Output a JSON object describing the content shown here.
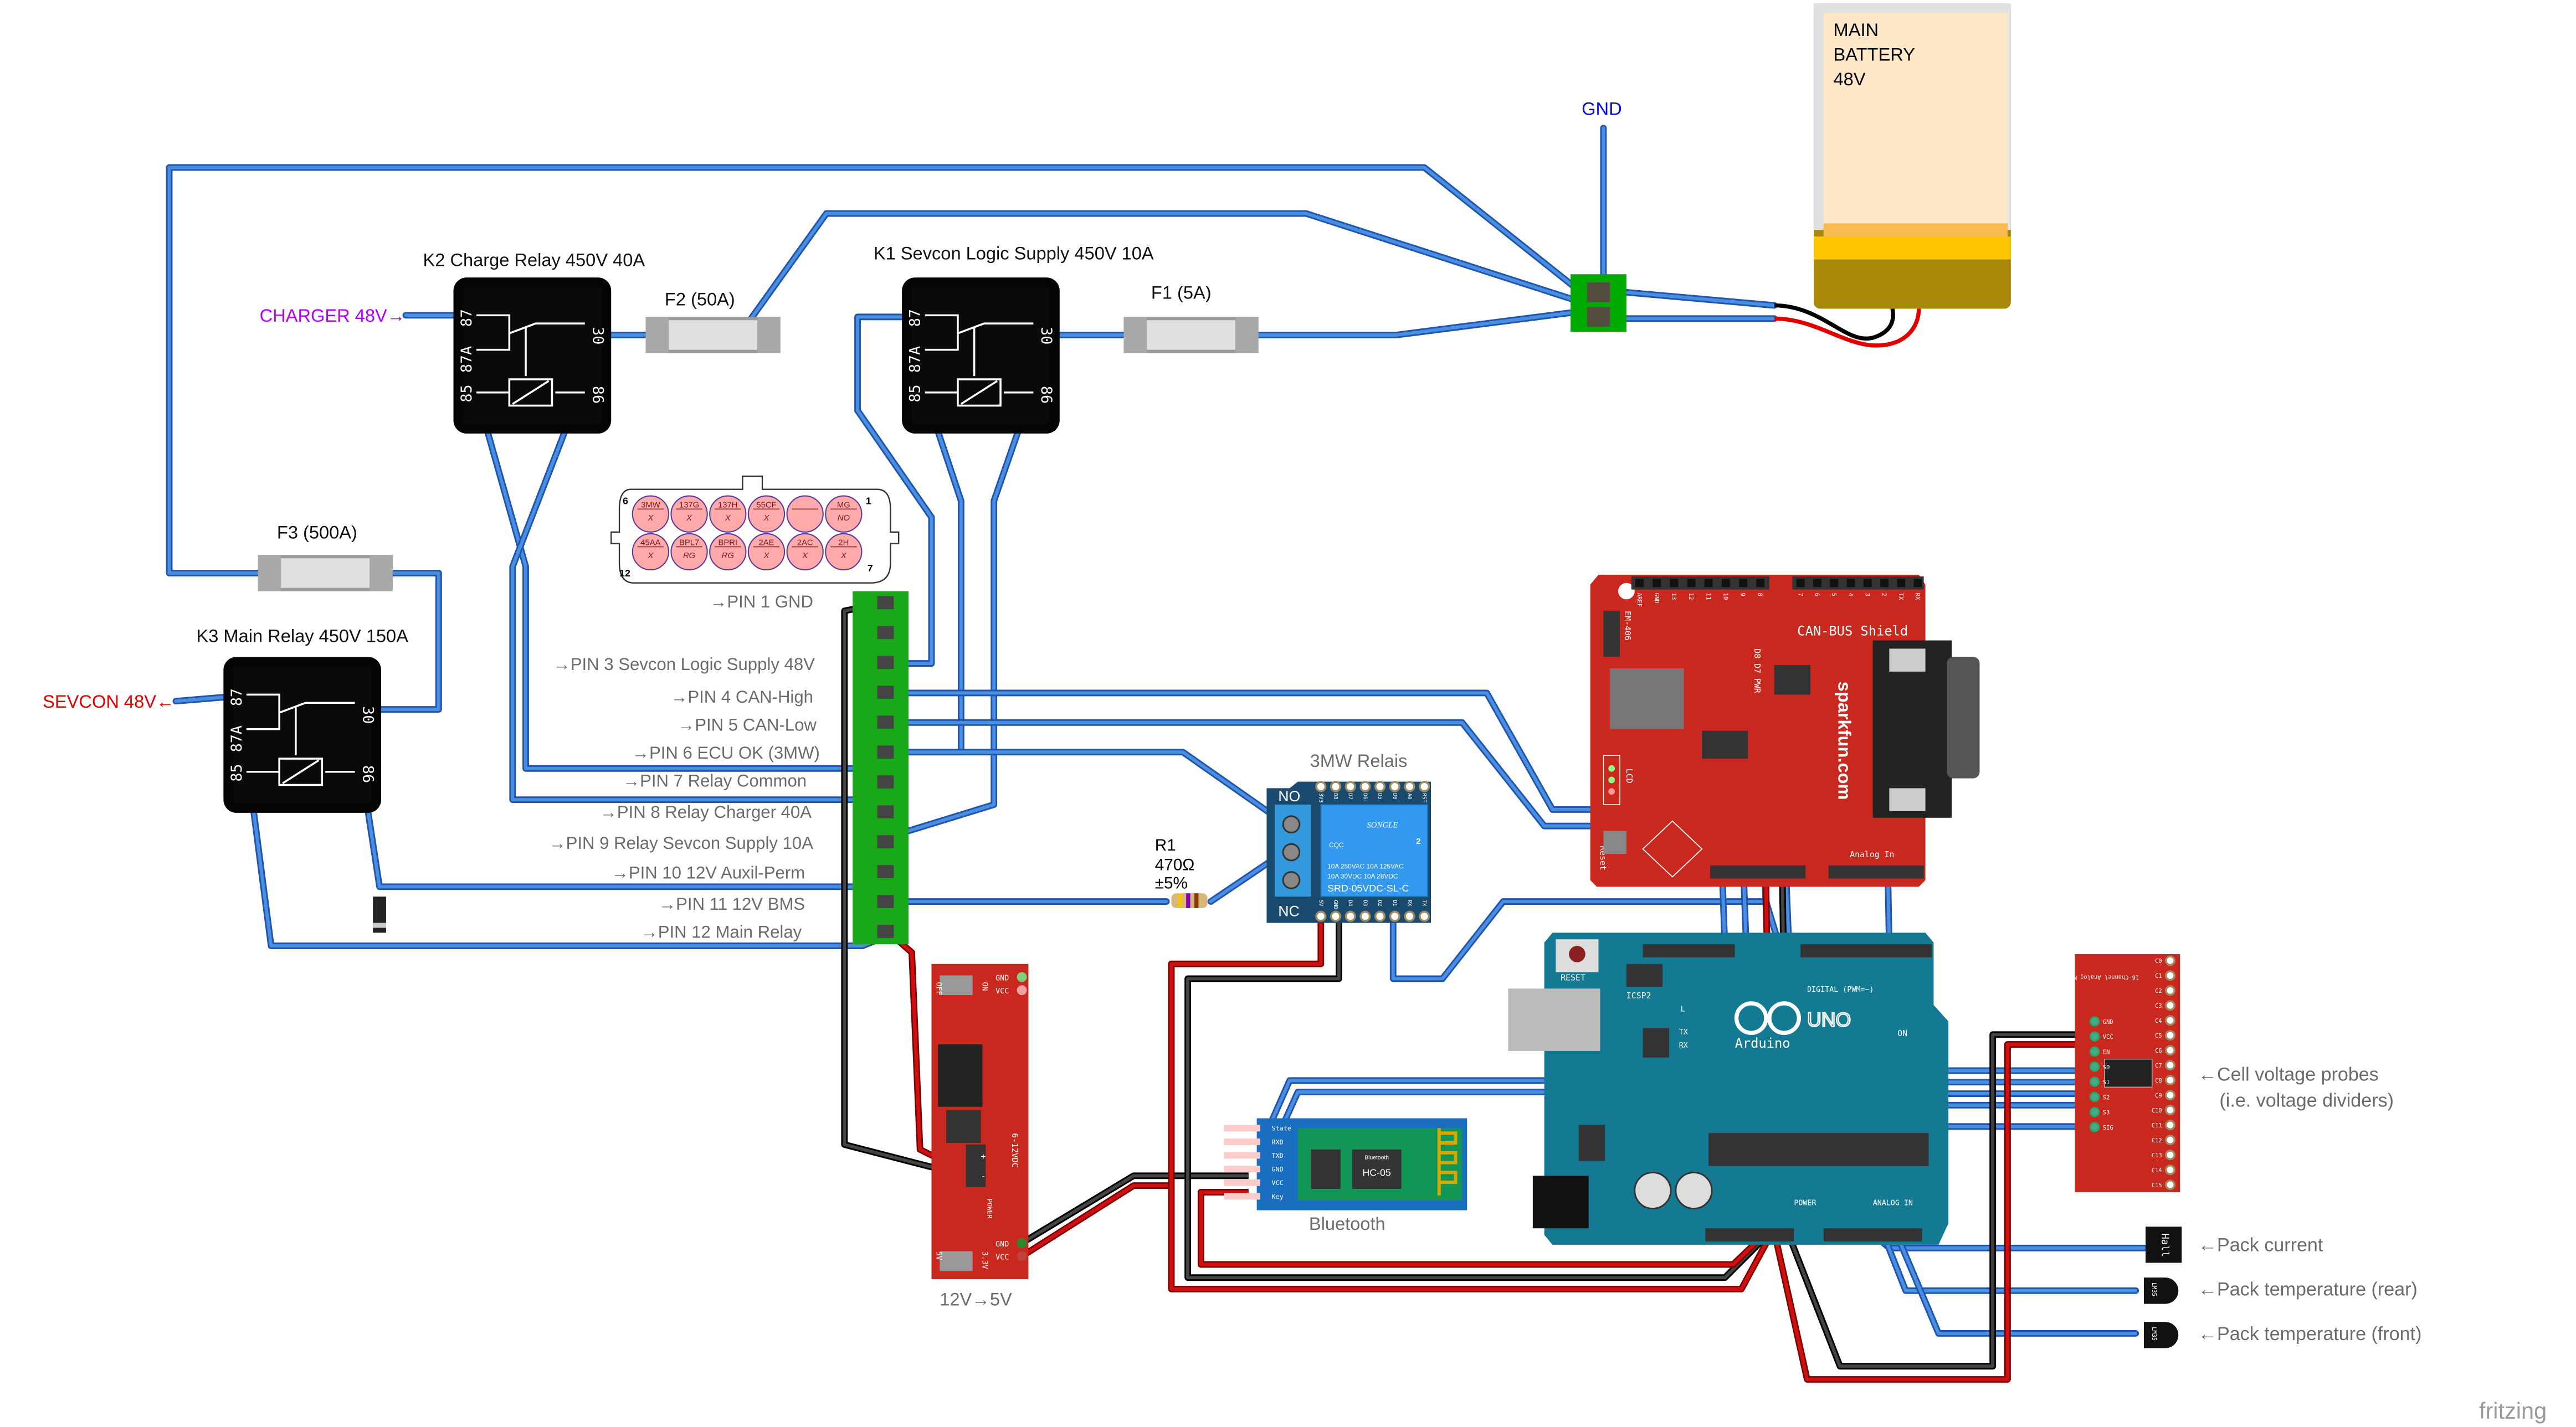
{
  "colors": {
    "wire": "#4a8ee0",
    "charger_label": "#b000ff",
    "sevcon_label": "#e00000",
    "gnd_label": "#0000ff",
    "arduino": "#147a94",
    "sparkfun_red": "#c8281e",
    "header_green": "#18a818"
  },
  "relays": {
    "k2": {
      "title": "K2 Charge Relay 450V 40A",
      "pins": [
        "87",
        "87A",
        "85",
        "30",
        "86"
      ]
    },
    "k1": {
      "title": "K1 Sevcon Logic Supply 450V 10A",
      "pins": [
        "87",
        "87A",
        "85",
        "30",
        "86"
      ]
    },
    "k3": {
      "title": "K3 Main Relay 450V 150A",
      "pins": [
        "87",
        "87A",
        "85",
        "30",
        "86"
      ]
    }
  },
  "fuses": {
    "f1": "F1 (5A)",
    "f2": "F2 (50A)",
    "f3": "F3 (500A)"
  },
  "charger_label": "CHARGER 48V→",
  "sevcon_label": "SEVCON 48V←",
  "gnd_label": "GND",
  "battery": {
    "line1": "MAIN",
    "line2": "BATTERY",
    "line3": "48V"
  },
  "connector": {
    "corner_labels": [
      "6",
      "1",
      "12",
      "7"
    ],
    "top_row": [
      {
        "top": "3MW",
        "bottom": "X"
      },
      {
        "top": "137G",
        "bottom": "X"
      },
      {
        "top": "137H",
        "bottom": "X"
      },
      {
        "top": "55CF",
        "bottom": "X"
      },
      {
        "top": "",
        "bottom": ""
      },
      {
        "top": "MG",
        "bottom": "NO"
      }
    ],
    "bottom_row": [
      {
        "top": "45AA",
        "bottom": "X"
      },
      {
        "top": "BPL7",
        "bottom": "RG"
      },
      {
        "top": "BPRI",
        "bottom": "RG"
      },
      {
        "top": "2AE",
        "bottom": "X"
      },
      {
        "top": "2AC",
        "bottom": "X"
      },
      {
        "top": "2H",
        "bottom": "X"
      }
    ]
  },
  "pins": [
    "→PIN 1 GND",
    "→PIN 3 Sevcon Logic Supply 48V",
    "→PIN 4 CAN-High",
    "→PIN 5 CAN-Low",
    "→PIN 6 ECU OK (3MW)",
    "→PIN 7 Relay Common",
    "→PIN 8 Relay Charger 40A",
    "→PIN 9 Relay Sevcon Supply 10A",
    "→PIN 10 12V Auxil-Perm",
    "→PIN 11 12V BMS",
    "→PIN 12 Main Relay"
  ],
  "relay_module": {
    "title": "3MW Relais",
    "no": "NO",
    "nc": "NC",
    "brand": "SONGLE",
    "rating1": "10A 250VAC  10A 125VAC",
    "rating2": "10A  30VDC  10A  28VDC",
    "model": "SRD-05VDC-SL-C",
    "cert": "CQC",
    "ul": "2",
    "top_pins": [
      "3V3",
      "D8",
      "D7",
      "D6",
      "D5",
      "D0",
      "A0",
      "RST"
    ],
    "bottom_pins": [
      "5V",
      "GND",
      "D4",
      "D3",
      "D2",
      "D1",
      "RX",
      "TX"
    ]
  },
  "resistor": {
    "name": "R1",
    "value": "470Ω",
    "tolerance": "±5%"
  },
  "regulator": {
    "title": "12V→5V",
    "labels": [
      "GND",
      "VCC",
      "OFF",
      "ON",
      "6-12VDC",
      "+",
      "-",
      "POWER",
      "GND",
      "VCC",
      "5V",
      "3.3V"
    ]
  },
  "bluetooth": {
    "title": "Bluetooth",
    "chip": "HC-05",
    "chip_sub": "Bluetooth",
    "pins": [
      "State",
      "RXD",
      "TXD",
      "GND",
      "VCC",
      "Key"
    ]
  },
  "can_shield": {
    "title": "CAN-BUS Shield",
    "brand": "sparkfun.com",
    "gps": "EM-406",
    "lcd": "LCD",
    "reset": "Reset",
    "leds": "D8 D7 PWR",
    "analog": "Analog In",
    "top_pins": [
      "AREF",
      "GND",
      "13",
      "12",
      "11",
      "10",
      "9",
      "8",
      "7",
      "6",
      "5",
      "4",
      "3",
      "2",
      "TX",
      "RX"
    ]
  },
  "arduino": {
    "reset": "RESET",
    "icsp": "ICSP2",
    "on": "ON",
    "digital": "DIGITAL (PWM=~)",
    "power": "POWER",
    "analog": "ANALOG IN",
    "brand": "Arduino",
    "model": "UNO",
    "led_l": "L",
    "tx": "TX",
    "rx": "RX"
  },
  "mux": {
    "title": "16-Channel Analog Multiplexer",
    "left_pins": [
      "GND",
      "VCC",
      "EN",
      "S0",
      "S1",
      "S2",
      "S3",
      "SIG"
    ],
    "right_pins": [
      "C0",
      "C1",
      "C2",
      "C3",
      "C4",
      "C5",
      "C6",
      "C7",
      "C8",
      "C9",
      "C10",
      "C11",
      "C12",
      "C13",
      "C14",
      "C15"
    ]
  },
  "sensors": {
    "cell_line1": "←Cell voltage probes",
    "cell_line2": "(i.e. voltage dividers)",
    "current": "←Pack current",
    "temp_rear": "←Pack temperature (rear)",
    "temp_front": "←Pack temperature (front)",
    "hall": "Hall",
    "lm35": "LM35"
  },
  "logo": "fritzing"
}
